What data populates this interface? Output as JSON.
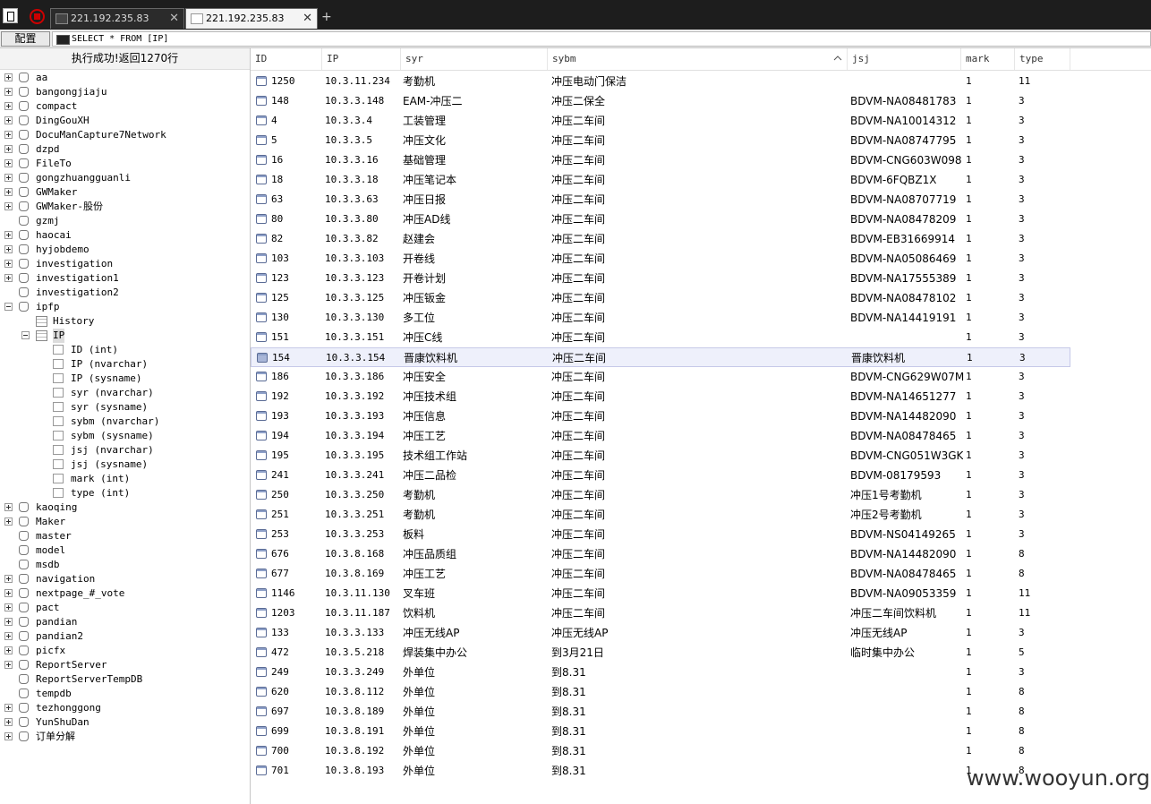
{
  "tabs": [
    {
      "label": "221.192.235.83",
      "close": "✕",
      "active": false
    },
    {
      "label": "221.192.235.83",
      "close": "✕",
      "active": true
    }
  ],
  "new_tab_label": "+",
  "toolbar": {
    "config_label": "配置",
    "query": "SELECT * FROM [IP]"
  },
  "status": "执行成功!返回1270行",
  "tree": [
    {
      "label": "aa",
      "level": 0,
      "type": "db",
      "expander": "plus"
    },
    {
      "label": "bangongjiaju",
      "level": 0,
      "type": "db",
      "expander": "plus"
    },
    {
      "label": "compact",
      "level": 0,
      "type": "db",
      "expander": "plus"
    },
    {
      "label": "DingGouXH",
      "level": 0,
      "type": "db",
      "expander": "plus"
    },
    {
      "label": "DocuManCapture7Network",
      "level": 0,
      "type": "db",
      "expander": "plus"
    },
    {
      "label": "dzpd",
      "level": 0,
      "type": "db",
      "expander": "plus"
    },
    {
      "label": "FileTo",
      "level": 0,
      "type": "db",
      "expander": "plus"
    },
    {
      "label": "gongzhuangguanli",
      "level": 0,
      "type": "db",
      "expander": "plus"
    },
    {
      "label": "GWMaker",
      "level": 0,
      "type": "db",
      "expander": "plus"
    },
    {
      "label": "GWMaker-股份",
      "level": 0,
      "type": "db",
      "expander": "plus"
    },
    {
      "label": "gzmj",
      "level": 0,
      "type": "db",
      "expander": "none"
    },
    {
      "label": "haocai",
      "level": 0,
      "type": "db",
      "expander": "plus"
    },
    {
      "label": "hyjobdemo",
      "level": 0,
      "type": "db",
      "expander": "plus"
    },
    {
      "label": "investigation",
      "level": 0,
      "type": "db",
      "expander": "plus"
    },
    {
      "label": "investigation1",
      "level": 0,
      "type": "db",
      "expander": "plus"
    },
    {
      "label": "investigation2",
      "level": 0,
      "type": "db",
      "expander": "none"
    },
    {
      "label": "ipfp",
      "level": 0,
      "type": "db",
      "expander": "minus"
    },
    {
      "label": "History",
      "level": 1,
      "type": "table",
      "expander": "none"
    },
    {
      "label": "IP",
      "level": 1,
      "type": "table",
      "expander": "minus",
      "selected": true
    },
    {
      "label": "ID (int)",
      "level": 2,
      "type": "col",
      "expander": "none"
    },
    {
      "label": "IP (nvarchar)",
      "level": 2,
      "type": "col",
      "expander": "none"
    },
    {
      "label": "IP (sysname)",
      "level": 2,
      "type": "col",
      "expander": "none"
    },
    {
      "label": "syr (nvarchar)",
      "level": 2,
      "type": "col",
      "expander": "none"
    },
    {
      "label": "syr (sysname)",
      "level": 2,
      "type": "col",
      "expander": "none"
    },
    {
      "label": "sybm (nvarchar)",
      "level": 2,
      "type": "col",
      "expander": "none"
    },
    {
      "label": "sybm (sysname)",
      "level": 2,
      "type": "col",
      "expander": "none"
    },
    {
      "label": "jsj (nvarchar)",
      "level": 2,
      "type": "col",
      "expander": "none"
    },
    {
      "label": "jsj (sysname)",
      "level": 2,
      "type": "col",
      "expander": "none"
    },
    {
      "label": "mark (int)",
      "level": 2,
      "type": "col",
      "expander": "none"
    },
    {
      "label": "type (int)",
      "level": 2,
      "type": "col",
      "expander": "none"
    },
    {
      "label": "kaoqing",
      "level": 0,
      "type": "db",
      "expander": "plus"
    },
    {
      "label": "Maker",
      "level": 0,
      "type": "db",
      "expander": "plus"
    },
    {
      "label": "master",
      "level": 0,
      "type": "db",
      "expander": "none"
    },
    {
      "label": "model",
      "level": 0,
      "type": "db",
      "expander": "none"
    },
    {
      "label": "msdb",
      "level": 0,
      "type": "db",
      "expander": "none"
    },
    {
      "label": "navigation",
      "level": 0,
      "type": "db",
      "expander": "plus"
    },
    {
      "label": "nextpage_#_vote",
      "level": 0,
      "type": "db",
      "expander": "plus"
    },
    {
      "label": "pact",
      "level": 0,
      "type": "db",
      "expander": "plus"
    },
    {
      "label": "pandian",
      "level": 0,
      "type": "db",
      "expander": "plus"
    },
    {
      "label": "pandian2",
      "level": 0,
      "type": "db",
      "expander": "plus"
    },
    {
      "label": "picfx",
      "level": 0,
      "type": "db",
      "expander": "plus"
    },
    {
      "label": "ReportServer",
      "level": 0,
      "type": "db",
      "expander": "plus"
    },
    {
      "label": "ReportServerTempDB",
      "level": 0,
      "type": "db",
      "expander": "none"
    },
    {
      "label": "tempdb",
      "level": 0,
      "type": "db",
      "expander": "none"
    },
    {
      "label": "tezhonggong",
      "level": 0,
      "type": "db",
      "expander": "plus"
    },
    {
      "label": "YunShuDan",
      "level": 0,
      "type": "db",
      "expander": "plus"
    },
    {
      "label": "订单分解",
      "level": 0,
      "type": "db",
      "expander": "plus"
    }
  ],
  "grid": {
    "columns": [
      "ID",
      "IP",
      "syr",
      "sybm",
      "jsj",
      "mark",
      "type"
    ],
    "sorted_column": "sybm",
    "selected_row": 14,
    "rows": [
      [
        "1250",
        "10.3.11.234",
        "考勤机",
        "冲压电动门保洁",
        "",
        "1",
        "11"
      ],
      [
        "148",
        "10.3.3.148",
        "EAM-冲压二",
        "冲压二保全",
        "BDVM-NA08481783",
        "1",
        "3"
      ],
      [
        "4",
        "10.3.3.4",
        "工装管理",
        "冲压二车间",
        "BDVM-NA10014312",
        "1",
        "3"
      ],
      [
        "5",
        "10.3.3.5",
        "冲压文化",
        "冲压二车间",
        "BDVM-NA08747795",
        "1",
        "3"
      ],
      [
        "16",
        "10.3.3.16",
        "基础管理",
        "冲压二车间",
        "BDVM-CNG603W098",
        "1",
        "3"
      ],
      [
        "18",
        "10.3.3.18",
        "冲压笔记本",
        "冲压二车间",
        "BDVM-6FQBZ1X",
        "1",
        "3"
      ],
      [
        "63",
        "10.3.3.63",
        "冲压日报",
        "冲压二车间",
        "BDVM-NA08707719",
        "1",
        "3"
      ],
      [
        "80",
        "10.3.3.80",
        "冲压AD线",
        "冲压二车间",
        "BDVM-NA08478209",
        "1",
        "3"
      ],
      [
        "82",
        "10.3.3.82",
        "赵建会",
        "冲压二车间",
        "BDVM-EB31669914",
        "1",
        "3"
      ],
      [
        "103",
        "10.3.3.103",
        "开卷线",
        "冲压二车间",
        "BDVM-NA05086469",
        "1",
        "3"
      ],
      [
        "123",
        "10.3.3.123",
        "开卷计划",
        "冲压二车间",
        "BDVM-NA17555389",
        "1",
        "3"
      ],
      [
        "125",
        "10.3.3.125",
        "冲压钣金",
        "冲压二车间",
        "BDVM-NA08478102",
        "1",
        "3"
      ],
      [
        "130",
        "10.3.3.130",
        "多工位",
        "冲压二车间",
        "BDVM-NA14419191",
        "1",
        "3"
      ],
      [
        "151",
        "10.3.3.151",
        "冲压C线",
        "冲压二车间",
        "",
        "1",
        "3"
      ],
      [
        "154",
        "10.3.3.154",
        "晋康饮料机",
        "冲压二车间",
        "晋康饮料机",
        "1",
        "3"
      ],
      [
        "186",
        "10.3.3.186",
        "冲压安全",
        "冲压二车间",
        "BDVM-CNG629W07M",
        "1",
        "3"
      ],
      [
        "192",
        "10.3.3.192",
        "冲压技术组",
        "冲压二车间",
        "BDVM-NA14651277",
        "1",
        "3"
      ],
      [
        "193",
        "10.3.3.193",
        "冲压信息",
        "冲压二车间",
        "BDVM-NA14482090",
        "1",
        "3"
      ],
      [
        "194",
        "10.3.3.194",
        "冲压工艺",
        "冲压二车间",
        "BDVM-NA08478465",
        "1",
        "3"
      ],
      [
        "195",
        "10.3.3.195",
        "技术组工作站",
        "冲压二车间",
        "BDVM-CNG051W3GK",
        "1",
        "3"
      ],
      [
        "241",
        "10.3.3.241",
        "冲压二品检",
        "冲压二车间",
        "BDVM-08179593",
        "1",
        "3"
      ],
      [
        "250",
        "10.3.3.250",
        "考勤机",
        "冲压二车间",
        "冲压1号考勤机",
        "1",
        "3"
      ],
      [
        "251",
        "10.3.3.251",
        "考勤机",
        "冲压二车间",
        "冲压2号考勤机",
        "1",
        "3"
      ],
      [
        "253",
        "10.3.3.253",
        "板料",
        "冲压二车间",
        "BDVM-NS04149265",
        "1",
        "3"
      ],
      [
        "676",
        "10.3.8.168",
        "冲压品质组",
        "冲压二车间",
        "BDVM-NA14482090",
        "1",
        "8"
      ],
      [
        "677",
        "10.3.8.169",
        "冲压工艺",
        "冲压二车间",
        "BDVM-NA08478465",
        "1",
        "8"
      ],
      [
        "1146",
        "10.3.11.130",
        "叉车班",
        "冲压二车间",
        "BDVM-NA09053359",
        "1",
        "11"
      ],
      [
        "1203",
        "10.3.11.187",
        "饮料机",
        "冲压二车间",
        "冲压二车间饮料机",
        "1",
        "11"
      ],
      [
        "133",
        "10.3.3.133",
        "冲压无线AP",
        "冲压无线AP",
        "冲压无线AP",
        "1",
        "3"
      ],
      [
        "472",
        "10.3.5.218",
        "焊装集中办公",
        "到3月21日",
        "临时集中办公",
        "1",
        "5"
      ],
      [
        "249",
        "10.3.3.249",
        "外单位",
        "到8.31",
        "",
        "1",
        "3"
      ],
      [
        "620",
        "10.3.8.112",
        "外单位",
        "到8.31",
        "",
        "1",
        "8"
      ],
      [
        "697",
        "10.3.8.189",
        "外单位",
        "到8.31",
        "",
        "1",
        "8"
      ],
      [
        "699",
        "10.3.8.191",
        "外单位",
        "到8.31",
        "",
        "1",
        "8"
      ],
      [
        "700",
        "10.3.8.192",
        "外单位",
        "到8.31",
        "",
        "1",
        "8"
      ],
      [
        "701",
        "10.3.8.193",
        "外单位",
        "到8.31",
        "",
        "1",
        "8"
      ]
    ]
  },
  "watermark": "www.wooyun.org",
  "colors": {
    "tabbar": "#1d1d1d",
    "selected_row": "#eef0fb",
    "stop": "#cc0000"
  }
}
